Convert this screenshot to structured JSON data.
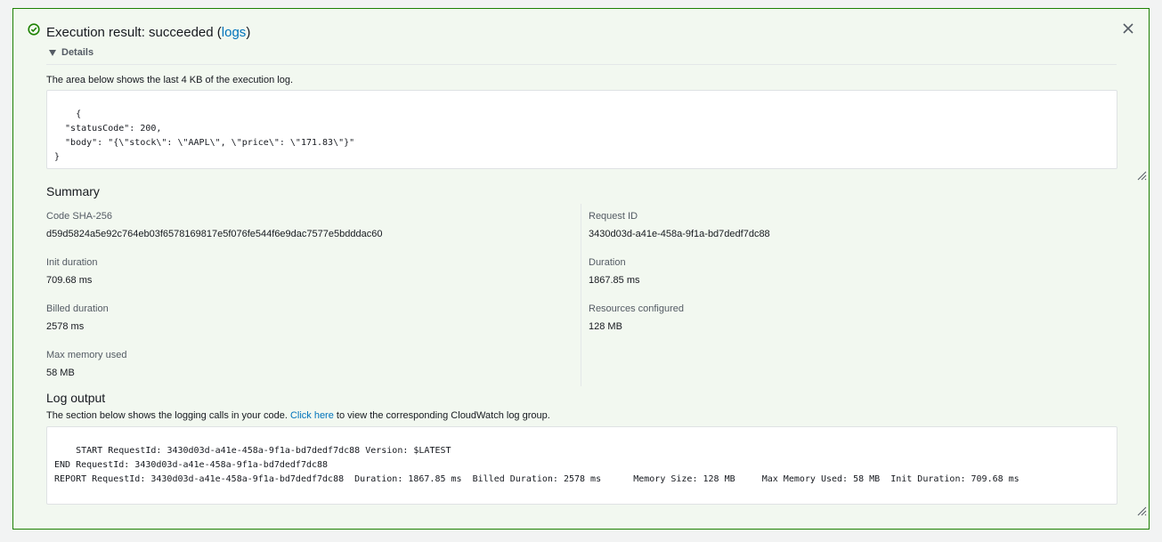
{
  "header": {
    "title_prefix": "Execution result: succeeded (",
    "logs_link": "logs",
    "title_suffix": ")",
    "status_icon": "check-circle-icon",
    "close_icon": "close-icon"
  },
  "details": {
    "toggle_label": "Details",
    "description": "The area below shows the last 4 KB of the execution log.",
    "response": "{\n  \"statusCode\": 200,\n  \"body\": \"{\\\"stock\\\": \\\"AAPL\\\", \\\"price\\\": \\\"171.83\\\"}\"\n}"
  },
  "summary": {
    "title": "Summary",
    "code_sha_label": "Code SHA-256",
    "code_sha_value": "d59d5824a5e92c764eb03f6578169817e5f076fe544f6e9dac7577e5bdddac60",
    "request_id_label": "Request ID",
    "request_id_value": "3430d03d-a41e-458a-9f1a-bd7dedf7dc88",
    "init_duration_label": "Init duration",
    "init_duration_value": "709.68 ms",
    "duration_label": "Duration",
    "duration_value": "1867.85 ms",
    "billed_duration_label": "Billed duration",
    "billed_duration_value": "2578 ms",
    "resources_label": "Resources configured",
    "resources_value": "128 MB",
    "max_memory_label": "Max memory used",
    "max_memory_value": "58 MB"
  },
  "log_output": {
    "title": "Log output",
    "description_prefix": "The section below shows the logging calls in your code. ",
    "click_here": "Click here",
    "description_suffix": " to view the corresponding CloudWatch log group.",
    "log_text": "START RequestId: 3430d03d-a41e-458a-9f1a-bd7dedf7dc88 Version: $LATEST\nEND RequestId: 3430d03d-a41e-458a-9f1a-bd7dedf7dc88\nREPORT RequestId: 3430d03d-a41e-458a-9f1a-bd7dedf7dc88  Duration: 1867.85 ms\tBilled Duration: 2578 ms\tMemory Size: 128 MB\tMax Memory Used: 58 MB\tInit Duration: 709.68 ms"
  },
  "colors": {
    "success_border": "#1d8102",
    "success_bg": "#f2f8f0",
    "link": "#0073bb"
  }
}
